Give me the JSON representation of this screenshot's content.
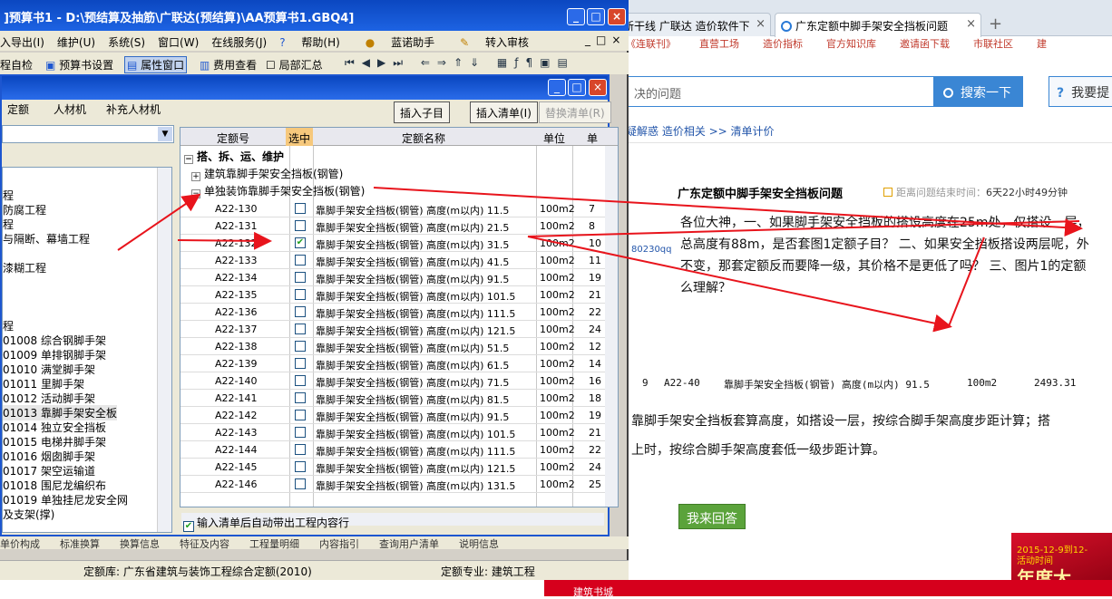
{
  "browser": {
    "tabs": [
      {
        "label": "新干线 广联达 造价软件下",
        "active": false
      },
      {
        "label": "广东定额中脚手架安全挡板问题",
        "active": true
      }
    ],
    "links": [
      "《连联刊》",
      "直营工场",
      "造价指标",
      "官方知识库",
      "邀请函下载",
      "市联社区",
      "建"
    ],
    "search_placeholder": "决的问题",
    "search_button": "搜索一下",
    "ask_button": "我要提",
    "breadcrumb": "疑解惑   造价相关  >>  清单计价",
    "question_title": "广东定额中脚手架安全挡板问题",
    "time_label": "距离问题结束时间：",
    "time_value": "6天22小时49分钟",
    "body_lines": [
      "各位大神，一、如果脚手架安全挡板的搭设高度在25m处，仅搭设一层，",
      "总高度有88m，是否套图1定额子目？ 二、如果安全挡板搭设两层呢，外",
      "不变，那套定额反而要降一级，其价格不是更低了吗？ 三、图片1的定额",
      "么理解？"
    ],
    "side_id": "80230qq",
    "image_row": {
      "no": "9",
      "code": "A22-40",
      "name": "靠脚手架安全挡板(钢管) 高度(m以内) 91.5",
      "unit": "100m2",
      "price": "2493.31"
    },
    "answer_line1": "靠脚手架安全挡板套算高度，如搭设一层，按综合脚手架高度步距计算；搭",
    "answer_line2": "上时，按综合脚手架高度套低一级步距计算。",
    "answer_button": "我来回答",
    "promo_date": "2015-12-9到12-",
    "promo_sub": "活动时间",
    "promo_big": "年度大",
    "stripe_label": "建筑书城"
  },
  "app": {
    "title": "]预算书1 - D:\\预结算及抽筋\\广联达(预结算)\\AA预算书1.GBQ4]",
    "menu": [
      "入导出(I)",
      "维护(U)",
      "系统(S)",
      "窗口(W)",
      "在线服务(J)",
      "帮助(H)",
      "蓝诺助手",
      "转入审核"
    ],
    "toolbar": [
      "程自检",
      "预算书设置",
      "属性窗口",
      "费用查看",
      "局部汇总"
    ],
    "dialog": {
      "tabs": [
        "定额",
        "人材机",
        "补充人材机"
      ],
      "buttons": [
        "插入子目",
        "插入清单(I)",
        "替换清单(R)"
      ],
      "left_tree": [
        {
          "text": "程",
          "sel": false
        },
        {
          "text": "防腐工程",
          "sel": false
        },
        {
          "text": "程",
          "sel": false
        },
        {
          "text": "与隔断、幕墙工程",
          "sel": false
        },
        {
          "text": "",
          "sel": false
        },
        {
          "text": "漆糊工程",
          "sel": false
        },
        {
          "text": "",
          "sel": false
        },
        {
          "text": "",
          "sel": false
        },
        {
          "text": "",
          "sel": false
        },
        {
          "text": "程",
          "sel": false
        },
        {
          "text": "01008   综合钢脚手架",
          "sel": false
        },
        {
          "text": "01009   单排钢脚手架",
          "sel": false
        },
        {
          "text": "01010   满堂脚手架",
          "sel": false
        },
        {
          "text": "01011   里脚手架",
          "sel": false
        },
        {
          "text": "01012   活动脚手架",
          "sel": false
        },
        {
          "text": "01013   靠脚手架安全板",
          "sel": true
        },
        {
          "text": "01014   独立安全挡板",
          "sel": false
        },
        {
          "text": "01015   电梯井脚手架",
          "sel": false
        },
        {
          "text": "01016   烟囱脚手架",
          "sel": false
        },
        {
          "text": "01017   架空运输道",
          "sel": false
        },
        {
          "text": "01018   围尼龙编织布",
          "sel": false
        },
        {
          "text": "01019   单独挂尼龙安全网",
          "sel": false
        },
        {
          "text": "及支架(撑)",
          "sel": false
        }
      ],
      "grid_headers": [
        "定额号",
        "选中",
        "定额名称",
        "单位",
        "单"
      ],
      "groups": [
        "搭、拆、运、维护",
        "建筑靠脚手架安全挡板(钢管)",
        "单独装饰靠脚手架安全挡板(钢管)"
      ],
      "rows": [
        {
          "code": "A22-130",
          "checked": false,
          "name": "靠脚手架安全挡板(钢管) 高度(m以内) 11.5",
          "unit": "100m2",
          "price": "7"
        },
        {
          "code": "A22-131",
          "checked": false,
          "name": "靠脚手架安全挡板(钢管) 高度(m以内) 21.5",
          "unit": "100m2",
          "price": "8"
        },
        {
          "code": "A22-132",
          "checked": true,
          "name": "靠脚手架安全挡板(钢管) 高度(m以内) 31.5",
          "unit": "100m2",
          "price": "10"
        },
        {
          "code": "A22-133",
          "checked": false,
          "name": "靠脚手架安全挡板(钢管) 高度(m以内) 41.5",
          "unit": "100m2",
          "price": "11"
        },
        {
          "code": "A22-134",
          "checked": false,
          "name": "靠脚手架安全挡板(钢管) 高度(m以内) 91.5",
          "unit": "100m2",
          "price": "19"
        },
        {
          "code": "A22-135",
          "checked": false,
          "name": "靠脚手架安全挡板(钢管) 高度(m以内) 101.5",
          "unit": "100m2",
          "price": "21"
        },
        {
          "code": "A22-136",
          "checked": false,
          "name": "靠脚手架安全挡板(钢管) 高度(m以内) 111.5",
          "unit": "100m2",
          "price": "22"
        },
        {
          "code": "A22-137",
          "checked": false,
          "name": "靠脚手架安全挡板(钢管) 高度(m以内) 121.5",
          "unit": "100m2",
          "price": "24"
        },
        {
          "code": "A22-138",
          "checked": false,
          "name": "靠脚手架安全挡板(钢管) 高度(m以内) 51.5",
          "unit": "100m2",
          "price": "12"
        },
        {
          "code": "A22-139",
          "checked": false,
          "name": "靠脚手架安全挡板(钢管) 高度(m以内) 61.5",
          "unit": "100m2",
          "price": "14"
        },
        {
          "code": "A22-140",
          "checked": false,
          "name": "靠脚手架安全挡板(钢管) 高度(m以内) 71.5",
          "unit": "100m2",
          "price": "16"
        },
        {
          "code": "A22-141",
          "checked": false,
          "name": "靠脚手架安全挡板(钢管) 高度(m以内) 81.5",
          "unit": "100m2",
          "price": "18"
        },
        {
          "code": "A22-142",
          "checked": false,
          "name": "靠脚手架安全挡板(钢管) 高度(m以内) 91.5",
          "unit": "100m2",
          "price": "19"
        },
        {
          "code": "A22-143",
          "checked": false,
          "name": "靠脚手架安全挡板(钢管) 高度(m以内) 101.5",
          "unit": "100m2",
          "price": "21"
        },
        {
          "code": "A22-144",
          "checked": false,
          "name": "靠脚手架安全挡板(钢管) 高度(m以内) 111.5",
          "unit": "100m2",
          "price": "22"
        },
        {
          "code": "A22-145",
          "checked": false,
          "name": "靠脚手架安全挡板(钢管) 高度(m以内) 121.5",
          "unit": "100m2",
          "price": "24"
        },
        {
          "code": "A22-146",
          "checked": false,
          "name": "靠脚手架安全挡板(钢管) 高度(m以内) 131.5",
          "unit": "100m2",
          "price": "25"
        }
      ],
      "auto_checkbox": "输入清单后自动带出工程内容行"
    },
    "lower_tabs": [
      "单价构成",
      "标准换算",
      "换算信息",
      "特征及内容",
      "工程量明细",
      "内容指引",
      "查询用户清单",
      "说明信息"
    ],
    "status_quota_lib": "定额库: 广东省建筑与装饰工程综合定额(2010)",
    "status_major": "定额专业: 建筑工程"
  },
  "colors": {
    "annotation_arrow": "#e8141c",
    "xp_blue": "#0b47c0",
    "selected_header": "#f6c87c"
  }
}
